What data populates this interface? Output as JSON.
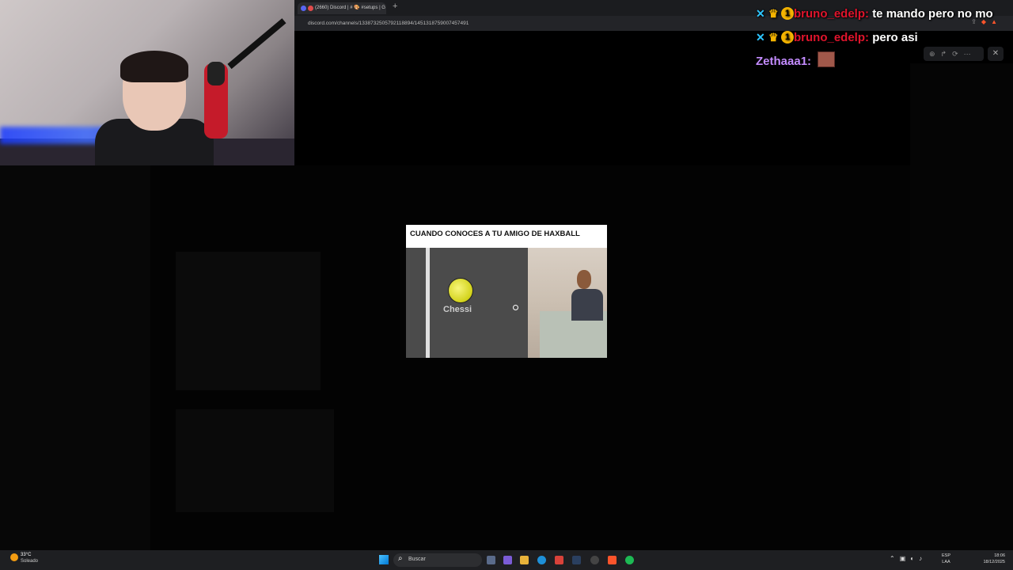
{
  "browser": {
    "tab_title": "(2660) Discord | # 🎨 #setups | G",
    "new_tab": "+",
    "url": "discord.com/channels/1338732505792118894/1451318759007457491"
  },
  "chat": {
    "lines": [
      {
        "user": "bruno_edelp:",
        "message": "te mando pero no mo",
        "user_color": "#e0142c"
      },
      {
        "user": "bruno_edelp:",
        "message": "pero asi",
        "user_color": "#e0142c"
      },
      {
        "user": "Zethaaa1:",
        "message": "",
        "user_color": "#c48cff"
      }
    ],
    "badges": {
      "sword": "sword-badge",
      "crown": "crown-badge",
      "sub": "1"
    }
  },
  "viewer": {
    "tools": [
      "zoom-icon",
      "forward-icon",
      "open-icon",
      "more-icon"
    ],
    "close": "✕"
  },
  "meme": {
    "caption": "CUANDO CONOCES A TU AMIGO DE HAXBALL",
    "player_name": "Chessi"
  },
  "taskbar": {
    "weather_temp": "33°C",
    "weather_desc": "Soleado",
    "search_placeholder": "Buscar",
    "lang_top": "ESP",
    "lang_bottom": "LAA",
    "time": "18:06",
    "date": "18/12/2025"
  },
  "colors": {
    "discord": "#5865f2",
    "brave": "#fb542b",
    "chat_user_red": "#e0142c",
    "chat_user_purple": "#c48cff",
    "ball_yellow": "#d2d21a"
  }
}
